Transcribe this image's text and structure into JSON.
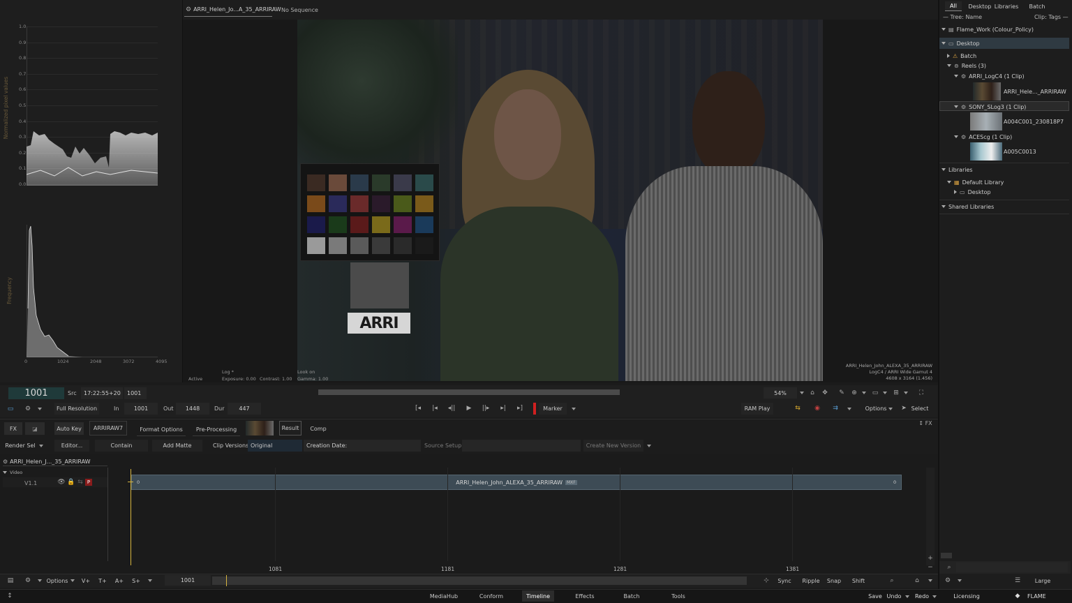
{
  "scopes": {
    "ytitle": "Normalized pixel values",
    "yticks": [
      "1.0",
      "0.9",
      "0.8",
      "0.7",
      "0.6",
      "0.5",
      "0.4",
      "0.3",
      "0.2",
      "0.1",
      "0.0"
    ],
    "hist_ylabel": "Frequency",
    "hist_xticks": [
      "0",
      "1024",
      "2048",
      "3072",
      "4095"
    ]
  },
  "viewer": {
    "clip_tab": "ARRI_Helen_Jo...A_35_ARRIRAW",
    "sequence_tab": "No Sequence",
    "overlay_active": "Active",
    "overlay_log": "Log *",
    "overlay_exposure": "Exposure: 0.00",
    "overlay_contrast": "Contrast: 1.00",
    "overlay_look": "Look on",
    "overlay_gamma": "Gamma: 1.00",
    "info_name": "ARRI_Helen_John_ALEXA_35_ARRIRAW",
    "info_space": "LogC4 / ARRI Wide Gamut 4",
    "info_res": "4608 x 3164 (1.456)",
    "chart_logo": "ARRI"
  },
  "transport": {
    "frame": "1001",
    "src_label": "Src",
    "timecode": "17:22:55+20",
    "src_frame": "1001",
    "zoom": "54%",
    "resolution": "Full Resolution",
    "in_label": "In",
    "in_value": "1001",
    "out_label": "Out",
    "out_value": "1448",
    "dur_label": "Dur",
    "dur_value": "447",
    "marker": "Marker",
    "ram_play": "RAM Play",
    "options": "Options",
    "select": "Select"
  },
  "tools": {
    "fx": "FX",
    "auto_key": "Auto Key",
    "arriraw": "ARRIRAW7",
    "format_options": "Format Options",
    "pre_processing": "Pre-Processing",
    "result": "Result",
    "comp": "Comp",
    "fx_right": "↕ FX",
    "render_sel": "Render Sel",
    "editor": "Editor...",
    "contain": "Contain",
    "add_matte": "Add Matte",
    "clip_versions": "Clip Versions",
    "original": "Original",
    "creation_date": "Creation Date:",
    "source_setup": "Source Setup",
    "create_new_version": "Create New Version"
  },
  "timeline": {
    "sequence_name": "ARRI_Helen_J..._35_ARRIRAW",
    "video_label": "Video",
    "track": "V1.1",
    "clip_name": "ARRI_Helen_John_ALEXA_35_ARRIRAW",
    "clip_tag": "MXF",
    "clip_start": "0",
    "clip_end": "0",
    "ruler": [
      "1081",
      "1181",
      "1281",
      "1381"
    ],
    "bottom_options": "Options",
    "v_plus": "V+",
    "t_plus": "T+",
    "a_plus": "A+",
    "s_plus": "S+",
    "frame": "1001",
    "sync": "Sync",
    "ripple": "Ripple",
    "snap": "Snap",
    "shift": "Shift"
  },
  "tabs": [
    "MediaHub",
    "Conform",
    "Timeline",
    "Effects",
    "Batch",
    "Tools"
  ],
  "active_tab": "Timeline",
  "footer": {
    "save": "Save",
    "undo": "Undo",
    "redo": "Redo",
    "licensing": "Licensing",
    "brand": "FLAME"
  },
  "library": {
    "tabs": [
      "All",
      "Desktop",
      "Libraries",
      "Batch"
    ],
    "tree_name": "— Tree: Name",
    "clip_tags": "Clip: Tags —",
    "project": "Flame_Work (Colour_Policy)",
    "desktop": "Desktop",
    "batch": "Batch",
    "reels": "Reels (3)",
    "reel1": "ARRI_LogC4 (1 Clip)",
    "clip1": "ARRI_Hele..._ARRIRAW",
    "reel2": "SONY_SLog3 (1 Clip)",
    "clip2": "A004C001_230818P7",
    "reel3": "ACEScg (1 Clip)",
    "clip3": "A005C0013",
    "libraries": "Libraries",
    "default_library": "Default Library",
    "lib_desktop": "Desktop",
    "shared_libraries": "Shared Libraries",
    "view_size": "Large"
  }
}
